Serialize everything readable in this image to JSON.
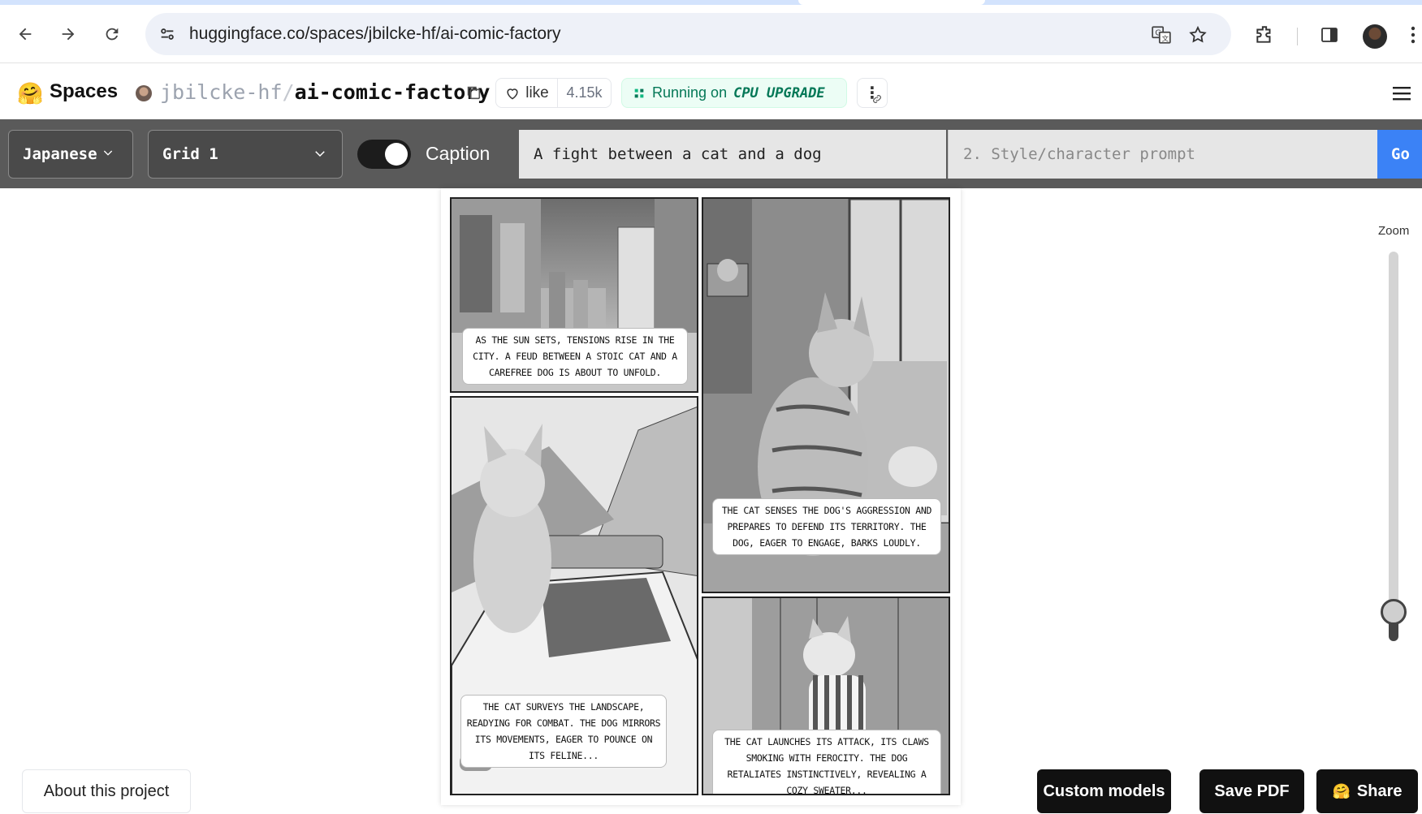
{
  "browser": {
    "url_host": "huggingface.co",
    "url_path": "/spaces/jbilcke-hf/ai-comic-factory"
  },
  "header": {
    "logo_emoji": "🤗",
    "spaces_label": "Spaces",
    "owner": "jbilcke-hf",
    "separator": "/",
    "repo": "ai-comic-factory",
    "like_label": "like",
    "like_count": "4.15k",
    "status_text": "Running on",
    "hardware": "CPU UPGRADE",
    "more_label": "⋮"
  },
  "app": {
    "style_select": "Japanese",
    "layout_select": "Grid 1",
    "caption_label": "Caption",
    "caption_enabled": true,
    "story_prompt_value": "A fight between a cat and a dog",
    "style_prompt_placeholder": "2. Style/character prompt",
    "go_label": "Go"
  },
  "comic": {
    "panels": [
      {
        "caption": "As the sun sets, tensions rise in the city. A feud between a stoic cat and a carefree dog is about to unfold."
      },
      {
        "caption": "The cat senses the dog's aggression and prepares to defend its territory. The dog, eager to engage, barks loudly."
      },
      {
        "caption": "The cat surveys the landscape, readying for combat. The dog mirrors its movements, eager to pounce on its feline..."
      },
      {
        "caption": "The cat launches its attack, its claws smoking with ferocity. The dog retaliates instinctively, revealing a cozy sweater..."
      }
    ]
  },
  "zoom": {
    "label": "Zoom",
    "level_fraction": 0.08
  },
  "footer": {
    "about_label": "About this project",
    "custom_models_label": "Custom models",
    "save_pdf_label": "Save PDF",
    "share_label": "Share",
    "share_emoji": "🤗"
  }
}
